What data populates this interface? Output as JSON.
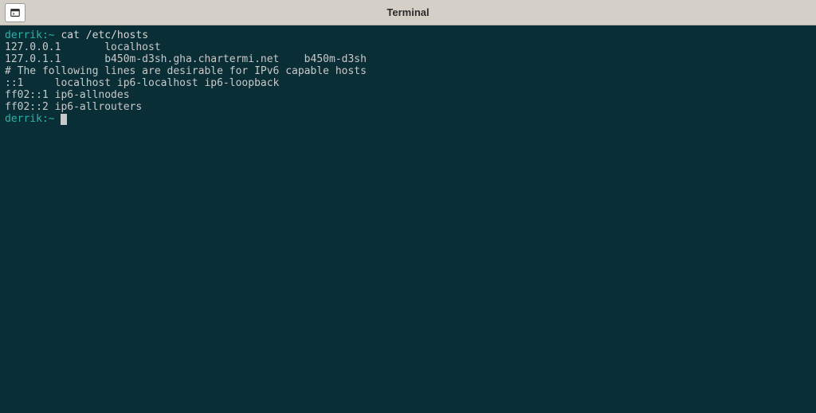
{
  "window": {
    "title": "Terminal"
  },
  "terminal": {
    "prompt1": "derrik:~",
    "command1": " cat /etc/hosts",
    "out1": "127.0.0.1       localhost",
    "out2": "127.0.1.1       b450m-d3sh.gha.chartermi.net    b450m-d3sh",
    "out3": "",
    "out4": "# The following lines are desirable for IPv6 capable hosts",
    "out5": "::1     localhost ip6-localhost ip6-loopback",
    "out6": "ff02::1 ip6-allnodes",
    "out7": "ff02::2 ip6-allrouters",
    "prompt2": "derrik:~"
  }
}
